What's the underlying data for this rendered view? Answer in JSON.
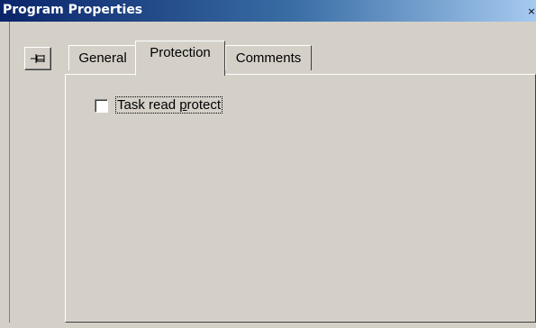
{
  "window": {
    "title": "Program Properties",
    "close_glyph": "×"
  },
  "toolbar": {
    "pin_icon": "pushpin-icon"
  },
  "tabs": [
    {
      "label": "General",
      "selected": false
    },
    {
      "label": "Protection",
      "selected": true
    },
    {
      "label": "Comments",
      "selected": false
    }
  ],
  "protection": {
    "task_read_protect": {
      "label_prefix": "Task read ",
      "label_accel": "p",
      "label_suffix": "rotect",
      "checked": false
    }
  },
  "colors": {
    "titlebar_start": "#0a246a",
    "titlebar_end": "#a6caf0",
    "face": "#d4d0c8"
  }
}
